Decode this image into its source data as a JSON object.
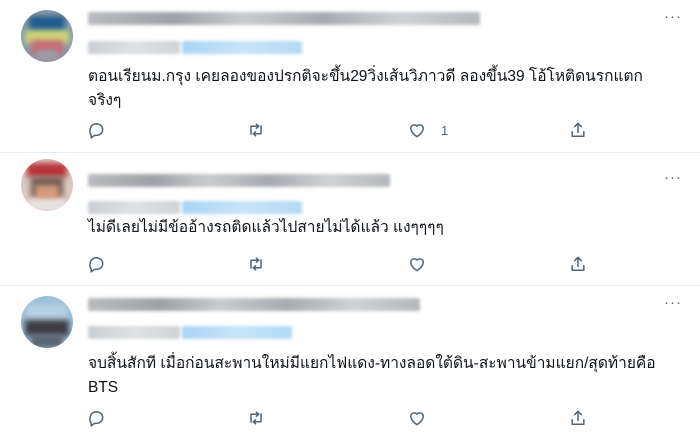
{
  "tweets": [
    {
      "text": "ตอนเรียนม.กรุง เคยลองของปรกติจะขึ้น29วิ่งเส้นวิภาวดี ลองขึ้น39 โอ้โหติดนรกแตก จริงๆ",
      "like_count": "1",
      "more_glyph": "···"
    },
    {
      "text": "ไม่ดีเลยไม่มีข้ออ้างรถติดแล้วไปสายไม่ได้แล้ว แงๆๆๆๆ",
      "like_count": "",
      "more_glyph": "···"
    },
    {
      "text": "จบสิ้นสักที เมื่อก่อนสะพานใหม่มีแยกไฟแดง-ทางลอดใต้ดิน-สะพานข้ามแยก/สุดท้ายคือ BTS",
      "like_count": "",
      "more_glyph": "···"
    }
  ],
  "icons": {
    "reply": "reply-icon",
    "retweet": "retweet-icon",
    "like": "like-icon",
    "share": "share-icon",
    "more": "more-icon"
  },
  "colors": {
    "icon_gray": "#536471",
    "divider": "#e6ecf0",
    "text": "#0f1419"
  }
}
